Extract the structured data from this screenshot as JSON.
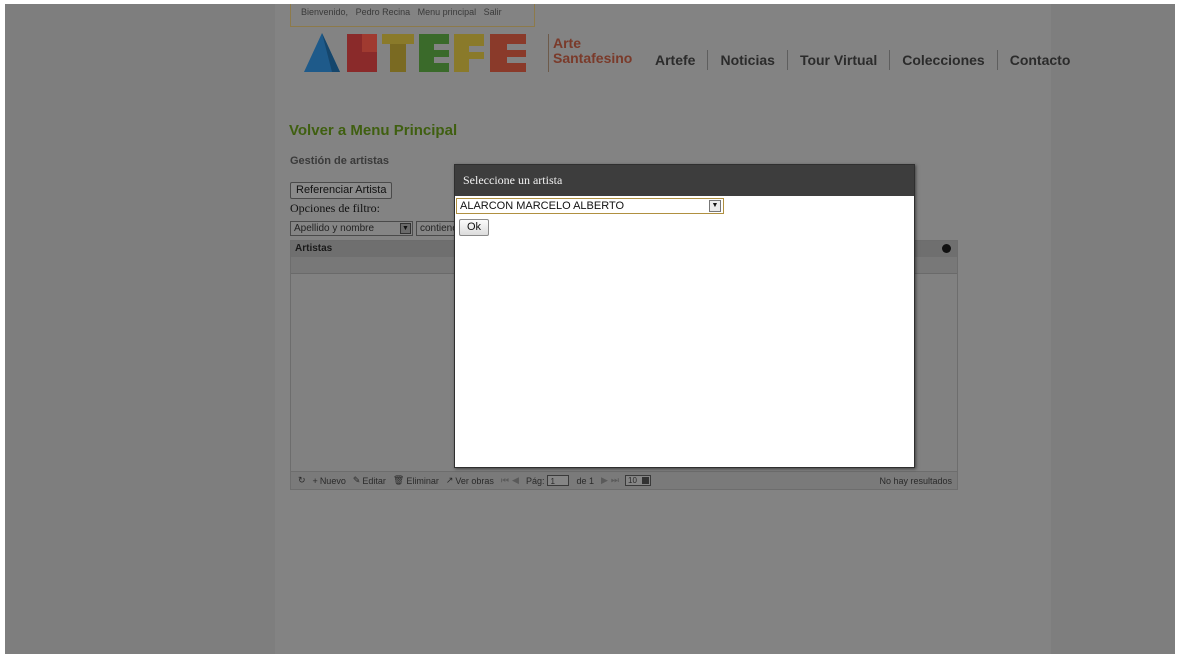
{
  "user_bar": {
    "welcome": "Bienvenido,",
    "user_name": "Pedro Recina",
    "main_menu": "Menu principal",
    "logout": "Salir"
  },
  "logo": {
    "word": "ARTEFE",
    "letter_colors": [
      "#1e5a8a",
      "#8a2a2a",
      "#8a7a2a",
      "#3a6a2a",
      "#8a7a2a",
      "#8a3a2a"
    ]
  },
  "brand": {
    "line1": "Arte",
    "line2": "Santafesino"
  },
  "nav": [
    "Artefe",
    "Noticias",
    "Tour Virtual",
    "Colecciones",
    "Contacto"
  ],
  "back_link": "Volver a Menu Principal",
  "section_title": "Gestión de artistas",
  "reference_button": "Referenciar Artista",
  "filter": {
    "label": "Opciones de filtro:",
    "field_value": "Apellido y nombre",
    "operator_value": "contiene"
  },
  "grid": {
    "caption": "Artistas",
    "pager": {
      "refresh_icon": "refresh-icon",
      "new": "Nuevo",
      "edit": "Editar",
      "delete": "Eliminar",
      "view_works": "Ver obras",
      "page_label": "Pág:",
      "page_value": "1",
      "of_label": "de 1",
      "rows_value": "10",
      "result_text": "No hay resultados"
    }
  },
  "dialog": {
    "title": "Seleccione un artista",
    "selected_artist": "ALARCON MARCELO ALBERTO",
    "ok_label": "Ok"
  }
}
